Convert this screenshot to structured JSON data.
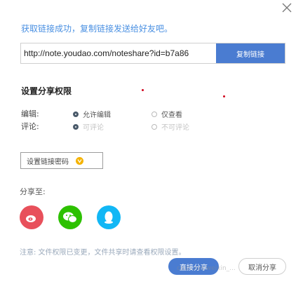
{
  "dialog": {
    "success_message": "获取链接成功，复制链接发送给好友吧。",
    "link": {
      "value": "http://note.youdao.com/noteshare?id=b7a86",
      "copy_label": "复制链接"
    },
    "permissions": {
      "title": "设置分享权限",
      "rows": [
        {
          "label": "编辑:",
          "options": [
            {
              "label": "允许编辑",
              "selected": true,
              "disabled": false
            },
            {
              "label": "仅查看",
              "selected": false,
              "disabled": false
            }
          ]
        },
        {
          "label": "评论:",
          "options": [
            {
              "label": "可评论",
              "selected": true,
              "disabled": true
            },
            {
              "label": "不可评论",
              "selected": false,
              "disabled": true
            }
          ]
        }
      ]
    },
    "password_label": "设置链接密码",
    "share_to_label": "分享至:",
    "share_targets": [
      {
        "name": "微博",
        "icon": "weibo-icon",
        "color": "#e8505b"
      },
      {
        "name": "微信",
        "icon": "wechat-icon",
        "color": "#2dc100"
      },
      {
        "name": "QQ",
        "icon": "qq-icon",
        "color": "#12b7f5"
      }
    ],
    "note": "注意: 文件权限已变更，文件共享时请查看权限设置。",
    "confirm_label": "直接分享",
    "cancel_label": "取消分享",
    "watermark": "csdn.net/weixin_..."
  }
}
